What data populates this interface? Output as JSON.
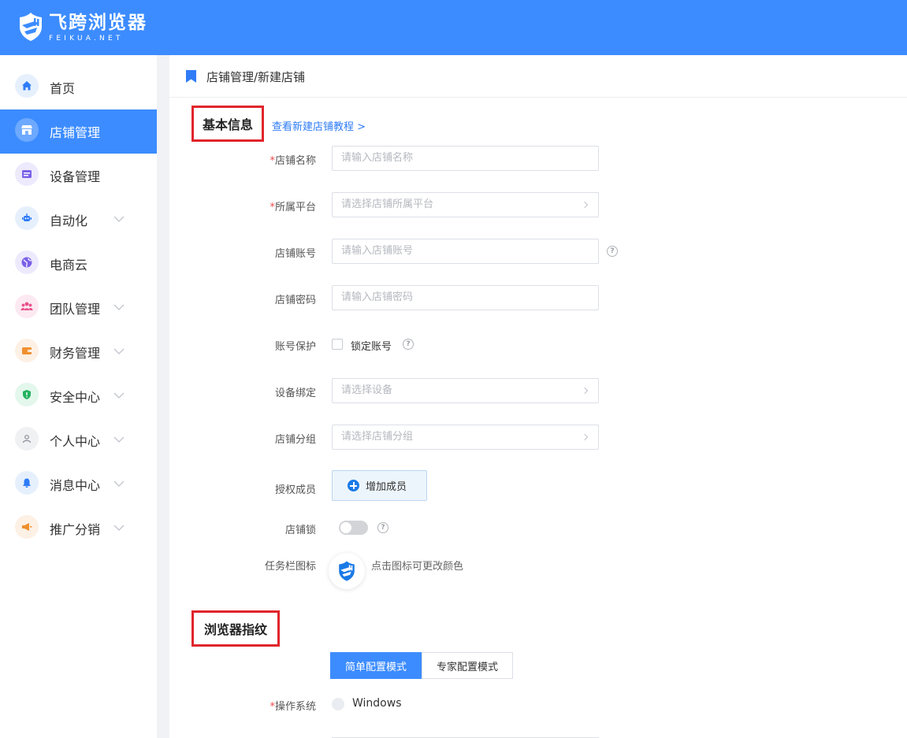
{
  "app": {
    "logo_title": "飞跨浏览器",
    "logo_sub": "FEIKUA.NET"
  },
  "colors": {
    "primary": "#3c8cff",
    "required": "#f04a4a",
    "highlight_box": "#e0252b"
  },
  "sidebar": {
    "items": [
      {
        "label": "首页",
        "icon": "home-icon",
        "expandable": false
      },
      {
        "label": "店铺管理",
        "icon": "store-icon",
        "expandable": false,
        "active": true
      },
      {
        "label": "设备管理",
        "icon": "device-icon",
        "expandable": false
      },
      {
        "label": "自动化",
        "icon": "robot-icon",
        "expandable": true
      },
      {
        "label": "电商云",
        "icon": "cloud-globe-icon",
        "expandable": false
      },
      {
        "label": "团队管理",
        "icon": "team-icon",
        "expandable": true
      },
      {
        "label": "财务管理",
        "icon": "wallet-icon",
        "expandable": true
      },
      {
        "label": "安全中心",
        "icon": "shield-icon",
        "expandable": true
      },
      {
        "label": "个人中心",
        "icon": "user-icon",
        "expandable": true
      },
      {
        "label": "消息中心",
        "icon": "bell-icon",
        "expandable": true
      },
      {
        "label": "推广分销",
        "icon": "megaphone-icon",
        "expandable": true
      }
    ]
  },
  "breadcrumb": {
    "text": "店铺管理/新建店铺"
  },
  "basic_info": {
    "title": "基本信息",
    "tutorial_link": "查看新建店铺教程 >",
    "fields": {
      "store_name": {
        "label": "店铺名称",
        "required": true,
        "placeholder": "请输入店铺名称"
      },
      "platform": {
        "label": "所属平台",
        "required": true,
        "placeholder": "请选择店铺所属平台"
      },
      "account": {
        "label": "店铺账号",
        "required": false,
        "placeholder": "请输入店铺账号"
      },
      "password": {
        "label": "店铺密码",
        "required": false,
        "placeholder": "请输入店铺密码"
      },
      "protection": {
        "label": "账号保护",
        "checkbox_label": "锁定账号",
        "checked": false
      },
      "device": {
        "label": "设备绑定",
        "placeholder": "请选择设备"
      },
      "group": {
        "label": "店铺分组",
        "placeholder": "请选择店铺分组"
      },
      "members": {
        "label": "授权成员",
        "button": "增加成员"
      },
      "lock": {
        "label": "店铺锁",
        "enabled": false
      },
      "taskbar_icon": {
        "label": "任务栏图标",
        "hint": "点击图标可更改颜色"
      }
    }
  },
  "fingerprint": {
    "title": "浏览器指纹",
    "modes": [
      "简单配置模式",
      "专家配置模式"
    ],
    "active_mode": 0,
    "os": {
      "label": "操作系统",
      "required": true,
      "option": "Windows"
    }
  },
  "required_mark": "*",
  "help_glyph": "?"
}
